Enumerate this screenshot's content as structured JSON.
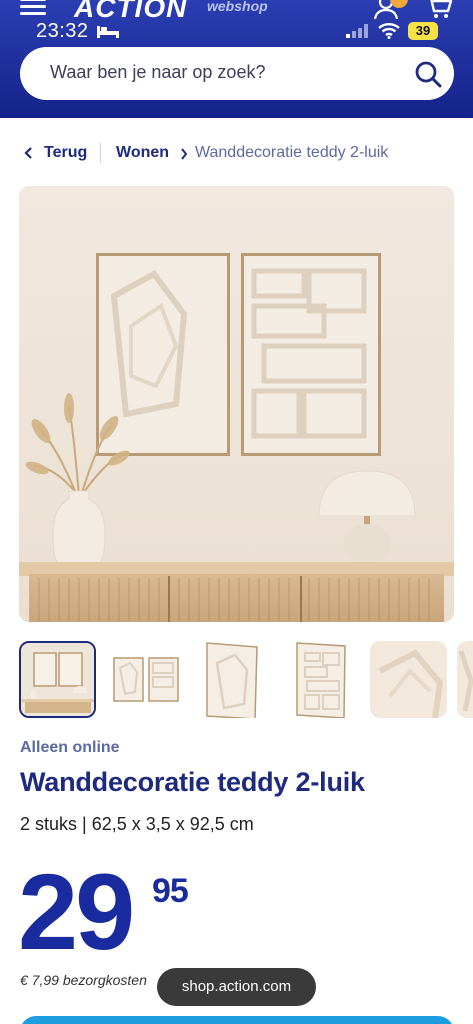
{
  "status_bar": {
    "time": "23:32",
    "battery": "39"
  },
  "header": {
    "logo": "ACTION",
    "logo_sub": "webshop"
  },
  "search": {
    "placeholder": "Waar ben je naar op zoek?"
  },
  "breadcrumb": {
    "back": "Terug",
    "category": "Wonen",
    "current": "Wanddecoratie teddy 2-luik"
  },
  "product": {
    "availability": "Alleen online",
    "title": "Wanddecoratie teddy 2-luik",
    "details": "2 stuks | 62,5 x 3,5 x 92,5 cm",
    "price_main": "29",
    "price_cents": "95",
    "shipping": "€ 7,99 bezorgkosten"
  },
  "toast": {
    "text": "shop.action.com"
  },
  "icons": {
    "menu": "hamburger-menu-icon",
    "account": "user-icon",
    "cart": "shopping-cart-icon",
    "search": "search-icon",
    "back": "chevron-left-icon",
    "breadcrumb_sep": "chevron-right-icon"
  },
  "colors": {
    "brand_blue": "#1e2a7d",
    "price_blue": "#1a2ba0",
    "header_blue": "#1f2e9c",
    "cta_blue": "#1c9ee0"
  }
}
